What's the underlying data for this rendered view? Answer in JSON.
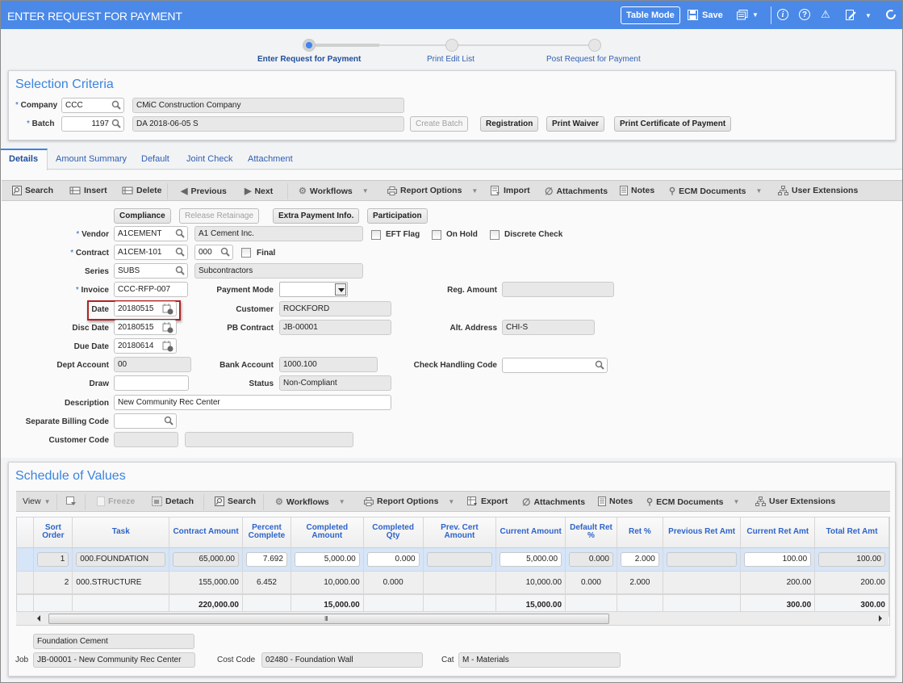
{
  "window": {
    "title": "ENTER REQUEST FOR PAYMENT",
    "table_mode_label": "Table Mode",
    "save_label": "Save"
  },
  "steps": [
    {
      "label": "Enter Request for Payment",
      "active": true
    },
    {
      "label": "Print Edit List",
      "active": false
    },
    {
      "label": "Post Request for Payment",
      "active": false
    }
  ],
  "selection_criteria": {
    "title": "Selection Criteria",
    "company_label": "Company",
    "company_code": "CCC",
    "company_name": "CMiC Construction Company",
    "batch_label": "Batch",
    "batch_number": "1197",
    "batch_description": "DA 2018-06-05 S",
    "buttons": {
      "create_batch": "Create Batch",
      "registration": "Registration",
      "print_waiver": "Print Waiver",
      "print_certificate": "Print Certificate of Payment"
    }
  },
  "tabs": [
    "Details",
    "Amount Summary",
    "Default",
    "Joint Check",
    "Attachment"
  ],
  "toolbar": {
    "search": "Search",
    "insert": "Insert",
    "delete": "Delete",
    "previous": "Previous",
    "next": "Next",
    "workflows": "Workflows",
    "report_options": "Report Options",
    "import": "Import",
    "attachments": "Attachments",
    "notes": "Notes",
    "ecm_documents": "ECM Documents",
    "user_extensions": "User Extensions"
  },
  "details": {
    "buttons": {
      "compliance": "Compliance",
      "release_retainage": "Release Retainage",
      "extra_payment_info": "Extra Payment Info.",
      "participation": "Participation"
    },
    "labels": {
      "vendor": "Vendor",
      "contract": "Contract",
      "series": "Series",
      "invoice": "Invoice",
      "date": "Date",
      "disc_date": "Disc Date",
      "due_date": "Due Date",
      "dept_account": "Dept Account",
      "draw": "Draw",
      "description": "Description",
      "separate_billing_code": "Separate Billing Code",
      "customer_code": "Customer Code",
      "payment_mode": "Payment Mode",
      "customer": "Customer",
      "pb_contract": "PB Contract",
      "bank_account": "Bank Account",
      "status": "Status",
      "reg_amount": "Reg. Amount",
      "alt_address": "Alt. Address",
      "check_handling_code": "Check Handling Code",
      "eft_flag": "EFT Flag",
      "on_hold": "On Hold",
      "discrete_check": "Discrete Check",
      "final": "Final"
    },
    "values": {
      "vendor_code": "A1CEMENT",
      "vendor_name": "A1 Cement Inc.",
      "contract_code": "A1CEM-101",
      "contract_sub": "000",
      "series_code": "SUBS",
      "series_name": "Subcontractors",
      "invoice": "CCC-RFP-007",
      "date": "20180515",
      "disc_date": "20180515",
      "due_date": "20180614",
      "dept_account": "00",
      "draw": "",
      "description": "New Community Rec Center",
      "separate_billing_code": "",
      "customer_code": "",
      "customer_code_name": "",
      "payment_mode": "",
      "customer": "ROCKFORD",
      "pb_contract": "JB-00001",
      "bank_account": "1000.100",
      "status": "Non-Compliant",
      "reg_amount": "",
      "alt_address": "CHI-S",
      "check_handling_code": "",
      "eft_flag": false,
      "on_hold": false,
      "discrete_check": false,
      "final": false
    }
  },
  "schedule_of_values": {
    "title": "Schedule of Values",
    "toolbar": {
      "view": "View",
      "freeze": "Freeze",
      "detach": "Detach",
      "search": "Search",
      "workflows": "Workflows",
      "report_options": "Report Options",
      "export": "Export",
      "attachments": "Attachments",
      "notes": "Notes",
      "ecm_documents": "ECM Documents",
      "user_extensions": "User Extensions"
    },
    "columns": [
      "Sort Order",
      "Task",
      "Contract Amount",
      "Percent Complete",
      "Completed Amount",
      "Completed Qty",
      "Prev. Cert Amount",
      "Current Amount",
      "Default Ret %",
      "Ret %",
      "Previous Ret Amt",
      "Current Ret Amt",
      "Total Ret Amt"
    ],
    "rows": [
      {
        "sort_order": "1",
        "task": "000.FOUNDATION",
        "contract_amount": "65,000.00",
        "percent_complete": "7.692",
        "completed_amount": "5,000.00",
        "completed_qty": "0.000",
        "prev_cert_amount": "",
        "current_amount": "5,000.00",
        "default_ret_pct": "0.000",
        "ret_pct": "2.000",
        "previous_ret_amt": "",
        "current_ret_amt": "100.00",
        "total_ret_amt": "100.00"
      },
      {
        "sort_order": "2",
        "task": "000.STRUCTURE",
        "contract_amount": "155,000.00",
        "percent_complete": "6.452",
        "completed_amount": "10,000.00",
        "completed_qty": "0.000",
        "prev_cert_amount": "",
        "current_amount": "10,000.00",
        "default_ret_pct": "0.000",
        "ret_pct": "2.000",
        "previous_ret_amt": "",
        "current_ret_amt": "200.00",
        "total_ret_amt": "200.00"
      }
    ],
    "totals": {
      "contract_amount": "220,000.00",
      "completed_amount": "15,000.00",
      "current_amount": "15,000.00",
      "current_ret_amt": "300.00",
      "total_ret_amt": "300.00"
    },
    "footer": {
      "task_description": "Foundation Cement",
      "job_label": "Job",
      "job": "JB-00001 - New Community Rec Center",
      "cost_code_label": "Cost Code",
      "cost_code": "02480 - Foundation Wall",
      "cat_label": "Cat",
      "cat": "M - Materials"
    }
  },
  "colors": {
    "title_bar": "#4a89e8",
    "accent": "#3b84e0",
    "highlight_border": "#b22222",
    "selected_row": "#d6e5f8"
  }
}
